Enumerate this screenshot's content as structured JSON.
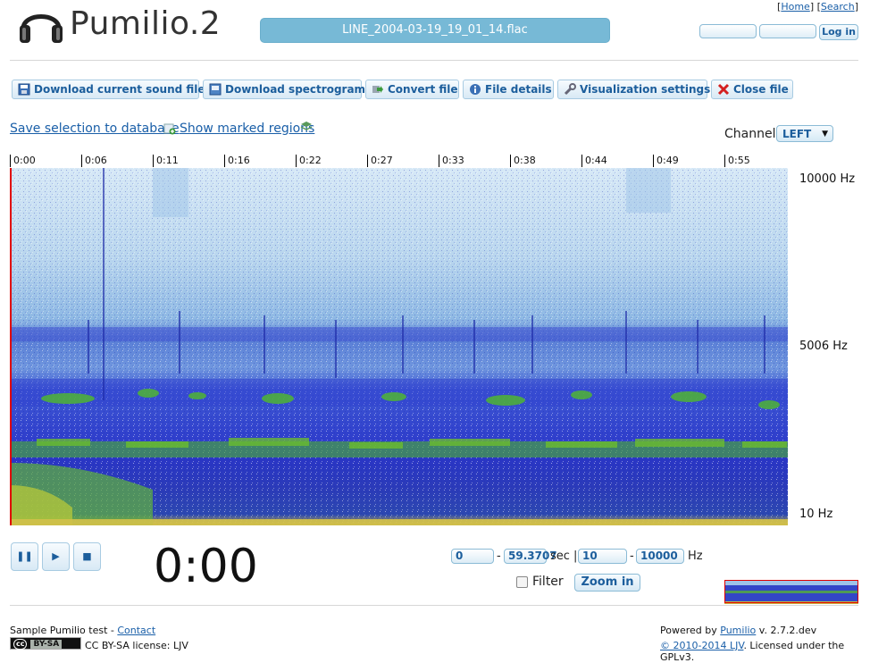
{
  "header": {
    "logo_text": "Pumilio.2",
    "logo_icon": "headphones-icon",
    "file_title": "LINE_2004-03-19_19_01_14.flac",
    "links": {
      "home": "Home",
      "search": "Search"
    },
    "login_label": "Log in"
  },
  "toolbar": {
    "buttons": [
      {
        "label": "Download current sound file",
        "icon": "save-disk-icon"
      },
      {
        "label": "Download spectrogram",
        "icon": "image-save-icon"
      },
      {
        "label": "Convert file",
        "icon": "convert-arrow-icon"
      },
      {
        "label": "File details",
        "icon": "info-icon"
      },
      {
        "label": "Visualization settings",
        "icon": "wrench-icon"
      },
      {
        "label": "Close file",
        "icon": "close-x-icon"
      }
    ]
  },
  "actions": {
    "save_selection": "Save selection to database",
    "show_marked": "Show marked regions"
  },
  "channel": {
    "label": "Channel:",
    "selected": "LEFT"
  },
  "time_ticks": [
    "0:00",
    "0:06",
    "0:11",
    "0:16",
    "0:22",
    "0:27",
    "0:33",
    "0:38",
    "0:44",
    "0:49",
    "0:55"
  ],
  "freq_labels": {
    "top": "10000 Hz",
    "mid": "5006 Hz",
    "bottom": "10 Hz"
  },
  "colors": {
    "accent": "#77b9d6",
    "link": "#1a5fa8",
    "cursor": "#e00000",
    "button_text": "#1c5e9c"
  },
  "player": {
    "pause_icon": "pause-icon",
    "play_icon": "play-icon",
    "stop_icon": "stop-icon",
    "time": "0:00"
  },
  "zoom": {
    "time_start": "0",
    "time_end": "59.3707",
    "time_unit": "sec |",
    "freq_start": "10",
    "freq_end": "10000",
    "freq_unit": "Hz",
    "dash": "-",
    "filter_label": "Filter",
    "zoom_label": "Zoom in"
  },
  "footer": {
    "site_name": "Sample Pumilio test - ",
    "contact": "Contact",
    "badge_cc": "cc",
    "badge_text": "BY-SA",
    "license": "CC BY-SA license: LJV",
    "powered_prefix": "Powered by ",
    "powered_link": "Pumilio",
    "powered_suffix": " v. 2.7.2.dev",
    "copyright_link": "© 2010-2014 LJV",
    "copyright_suffix": ". Licensed under the GPLv3."
  }
}
